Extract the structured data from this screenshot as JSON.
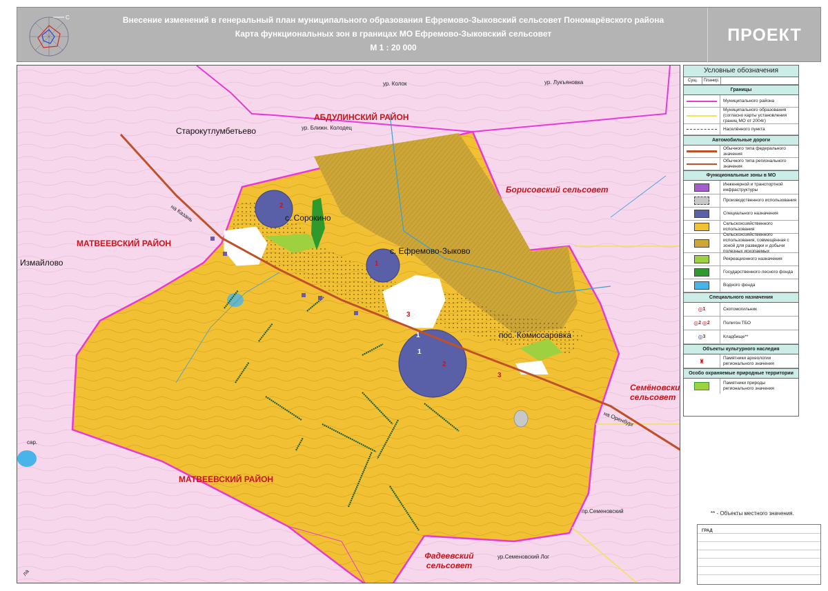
{
  "header": {
    "line1": "Внесение изменений в генеральный план муниципального образования Ефремово-Зыковский сельсовет Пономарёвского района",
    "line2": "Карта функциональных  зон  в  границах   МО Ефремово-Зыковский сельсовет",
    "scale": "М 1 : 20 000",
    "status": "ПРОЕКТ",
    "compass_letter": "С"
  },
  "map": {
    "districts": {
      "abdulinsky": "АБДУЛИНСКИЙ РАЙОН",
      "matveevsky_w": "МАТВЕЕВСКИЙ РАЙОН",
      "matveevsky_s": "МАТВЕЕВСКИЙ РАЙОН",
      "borisovsky": "Борисовский сельсовет",
      "semenovsky": "Семёновский сельсовет",
      "fadeevsky": "Фадеевский сельсовет"
    },
    "settlements": {
      "starokutlumbetyevo": "Старокутлумбетьево",
      "izmaylovo": "Измайлово",
      "sorokino": "с. Сорокино",
      "efremovo": "с. Ефремово-Зыково",
      "komissarovka": "пос. Комиссаровка"
    },
    "places": {
      "kolok": "ур. Колок",
      "lukyanovka": "ур. Лукъяновка",
      "kolodets": "ур. Ближн. Колодец",
      "semenovsky_pr": "пр.Семеновский",
      "semenovsky_log": "ур.Семеновский Лог",
      "sar": "сар.",
      "kazan": "на Казань",
      "orenburg": "на Оренбург",
      "bottom_left": "ла"
    },
    "markers": {
      "n1a": "1",
      "n1b": "1",
      "n1c": "1",
      "n2a": "2",
      "n2b": "2",
      "n3a": "3",
      "n3b": "3"
    }
  },
  "legend": {
    "title": "Условные обозначения",
    "col_exist": "Сущ.",
    "col_plan": "Планир.",
    "sections": {
      "borders": "Границы",
      "roads": "Автомобильные дороги",
      "zones": "Функциональные зоны в МО",
      "special": "Специального назначения",
      "heritage": "Объекты культурного наследия",
      "protected": "Особо охраняемые природные территории"
    },
    "borders": [
      "Муниципального района",
      "Муниципального образования (согласно карты установления границ МО от 2004г)",
      "Населённого пункта"
    ],
    "roads": [
      "Обычного типа федерального значения",
      "Обычного типа регионального значения"
    ],
    "zones": [
      {
        "label": "Инженерной и транспортной инфраструктуры",
        "color": "#a65ccf"
      },
      {
        "label": "Производственного использования",
        "color": "#c8c8c8"
      },
      {
        "label": "Специального назначения",
        "color": "#5960a8"
      },
      {
        "label": "Сельскохозяйственного использования",
        "color": "#f2c033"
      },
      {
        "label": "Сельскохозяйственного использования, совмещённая с зоной для разведки и добычи полезных ископаемых",
        "color": "#cda637"
      },
      {
        "label": "Рекреационного назначения",
        "color": "#9ed13f"
      },
      {
        "label": "Государственного лесного фонда",
        "color": "#2e9a2e"
      },
      {
        "label": "Водного  фонда",
        "color": "#48b4ea"
      }
    ],
    "special": [
      {
        "label": "Скотомогильник",
        "num": "1"
      },
      {
        "label": "Полигон ТБО",
        "num": "2",
        "num2": "2"
      },
      {
        "label": "Кладбище**",
        "num": "3"
      }
    ],
    "heritage": [
      "Памятники археологии регионального значения"
    ],
    "protected": [
      "Памятники природы регионального значения"
    ]
  },
  "footer": {
    "note": "** - Объекты местного значения.",
    "org": "ГРАД"
  },
  "colors": {
    "header_bg": "#b4b4b4",
    "outside": "#f7d7ec",
    "agri": "#f2c033",
    "mining": "#cda637",
    "special": "#5960a8",
    "district_border": "#e838d6",
    "road": "#c0502a",
    "district_label": "#c4161c"
  }
}
